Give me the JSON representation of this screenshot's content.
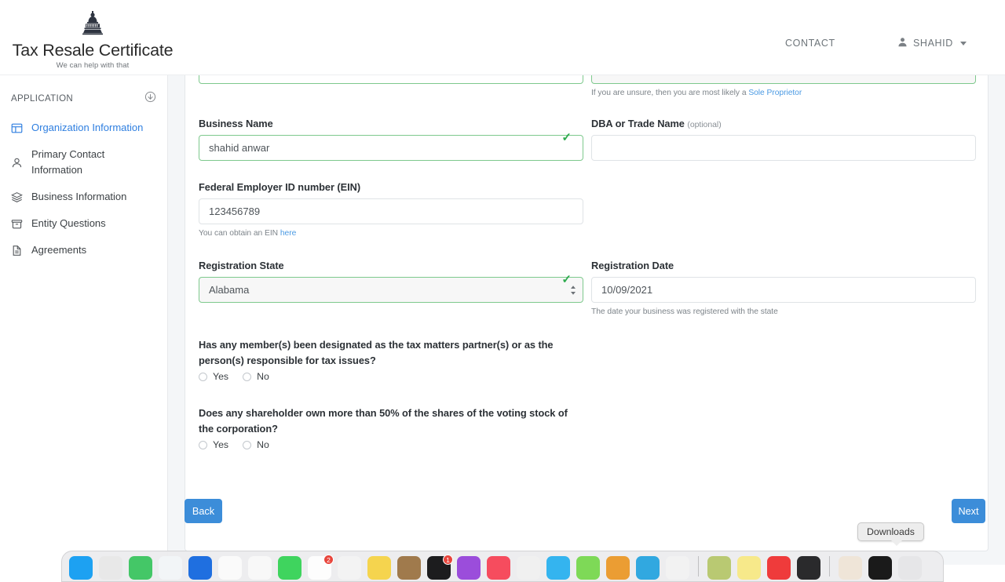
{
  "header": {
    "brand_title": "Tax Resale Certificate",
    "brand_tagline": "We can help with that",
    "brand_icon": "capitol-dome-icon",
    "contact_label": "CONTACT",
    "user_name": "SHAHID",
    "user_icon": "person-icon",
    "caret_icon": "caret-down-icon"
  },
  "sidebar": {
    "section_label": "APPLICATION",
    "collapse_icon": "circle-arrow-down-icon",
    "items": [
      {
        "label": "Organization Information",
        "icon": "layout-panels-icon",
        "active": true
      },
      {
        "label": "Primary Contact Information",
        "icon": "person-icon",
        "active": false
      },
      {
        "label": "Business Information",
        "icon": "layers-icon",
        "active": false
      },
      {
        "label": "Entity Questions",
        "icon": "archive-box-icon",
        "active": false
      },
      {
        "label": "Agreements",
        "icon": "document-icon",
        "active": false
      }
    ]
  },
  "form": {
    "entity_hint_prefix": "If you are unsure, then you are most likely a ",
    "entity_hint_link": "Sole Proprietor",
    "business_name": {
      "label": "Business Name",
      "value": "shahid anwar",
      "placeholder": "",
      "valid": true,
      "check_icon": "check-mark-icon"
    },
    "dba": {
      "label": "DBA or Trade Name",
      "optional_tag": "(optional)",
      "value": "",
      "placeholder": ""
    },
    "ein": {
      "label": "Federal Employer ID number (EIN)",
      "value": "123456789",
      "placeholder": "",
      "hint_prefix": "You can obtain an EIN ",
      "hint_link": "here"
    },
    "registration_state": {
      "label": "Registration State",
      "value": "Alabama",
      "valid": true,
      "check_icon": "check-mark-icon",
      "stepper_icon": "select-stepper-icon",
      "options": [
        "Alabama"
      ]
    },
    "registration_date": {
      "label": "Registration Date",
      "value": "10/09/2021",
      "placeholder": "",
      "hint": "The date your business was registered with the state"
    },
    "questions": [
      {
        "text": "Has any member(s) been designated as the tax matters partner(s) or as the person(s) responsible for tax issues?",
        "options": [
          "Yes",
          "No"
        ],
        "selected": ""
      },
      {
        "text": "Does any shareholder own more than 50% of the shares of the voting stock of the corporation?",
        "options": [
          "Yes",
          "No"
        ],
        "selected": ""
      }
    ]
  },
  "footer": {
    "back_label": "Back",
    "next_label": "Next"
  },
  "tooltip": {
    "text": "Downloads"
  },
  "colors": {
    "accent_blue": "#3c8dd9",
    "link_blue": "#4b9ae3",
    "active_nav": "#2f7fe0",
    "valid_green": "#7ec98d",
    "check_green": "#2eab4e",
    "page_bg": "#f4f6f8"
  },
  "dock": {
    "items": [
      {
        "name": "finder",
        "color": "#1da1f2",
        "badge": ""
      },
      {
        "name": "launchpad",
        "color": "#e8e8e8",
        "badge": ""
      },
      {
        "name": "messages",
        "color": "#44c767",
        "badge": ""
      },
      {
        "name": "safari",
        "color": "#f2f5f7",
        "badge": ""
      },
      {
        "name": "mail",
        "color": "#1f6fe0",
        "badge": ""
      },
      {
        "name": "photos",
        "color": "#fafafa",
        "badge": ""
      },
      {
        "name": "app-store",
        "color": "#f8f8f8",
        "badge": ""
      },
      {
        "name": "facetime",
        "color": "#3fd45e",
        "badge": ""
      },
      {
        "name": "calendar",
        "color": "#fdfdfd",
        "badge": "2"
      },
      {
        "name": "contacts",
        "color": "#f3f3f3",
        "badge": ""
      },
      {
        "name": "notes",
        "color": "#f5d44e",
        "badge": ""
      },
      {
        "name": "reminders",
        "color": "#a07a4c",
        "badge": ""
      },
      {
        "name": "tv",
        "color": "#1c1c1e",
        "badge": "1"
      },
      {
        "name": "podcasts",
        "color": "#9b4ddb",
        "badge": ""
      },
      {
        "name": "music",
        "color": "#f64c5e",
        "badge": ""
      },
      {
        "name": "keynote",
        "color": "#f0f0f0",
        "badge": ""
      },
      {
        "name": "numbers",
        "color": "#34b4ef",
        "badge": ""
      },
      {
        "name": "pages",
        "color": "#7ed957",
        "badge": ""
      },
      {
        "name": "xcode",
        "color": "#eb9d33",
        "badge": ""
      },
      {
        "name": "sublime-text",
        "color": "#31a8e0",
        "badge": ""
      },
      {
        "name": "github",
        "color": "#f2f2f2",
        "badge": ""
      },
      {
        "name": "separator-1",
        "color": "",
        "badge": ""
      },
      {
        "name": "preview",
        "color": "#b9c972",
        "badge": ""
      },
      {
        "name": "stickies",
        "color": "#f7e98a",
        "badge": ""
      },
      {
        "name": "opera",
        "color": "#ef3b3b",
        "badge": ""
      },
      {
        "name": "terminal",
        "color": "#2a2a2c",
        "badge": ""
      },
      {
        "name": "separator-2",
        "color": "",
        "badge": ""
      },
      {
        "name": "screenshot",
        "color": "#efe5d8",
        "badge": ""
      },
      {
        "name": "downloads",
        "color": "#1a1a1a",
        "badge": ""
      },
      {
        "name": "trash",
        "color": "#e6e6e8",
        "badge": ""
      }
    ]
  }
}
